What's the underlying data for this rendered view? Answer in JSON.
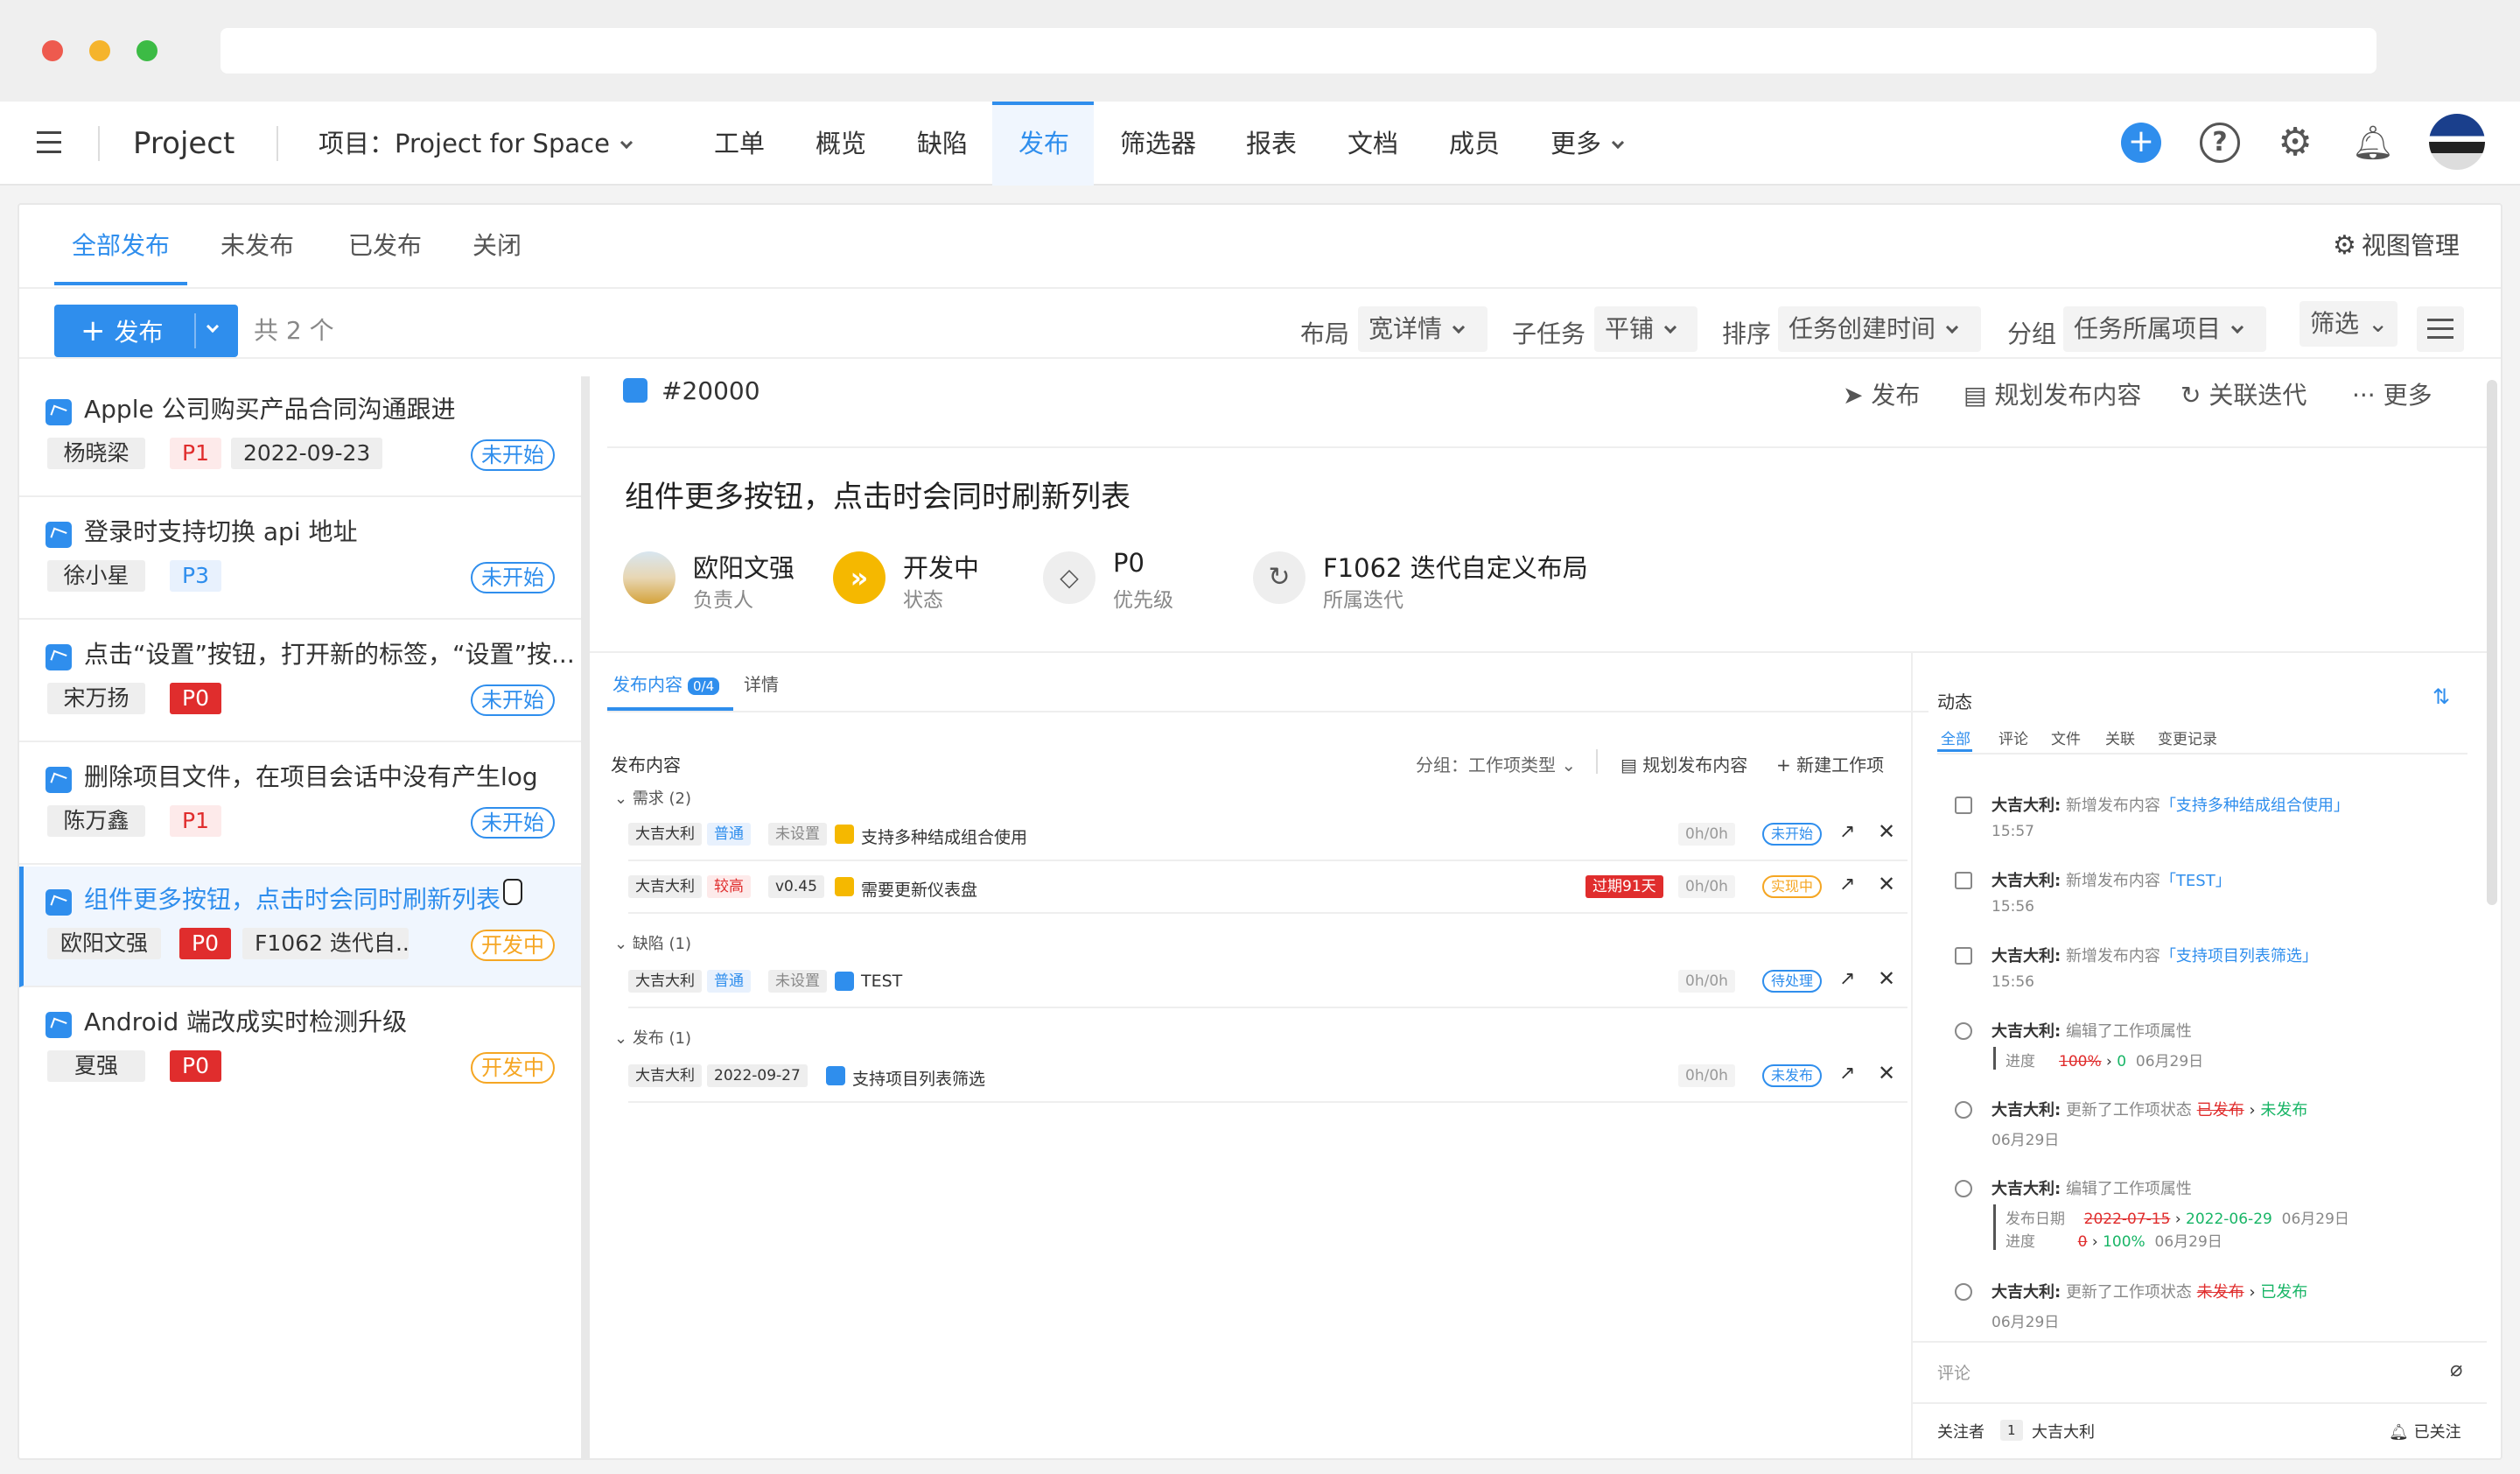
{
  "nav": {
    "project_label": "Project",
    "project_selector": "项目：Project for Space",
    "items": [
      "工单",
      "概览",
      "缺陷",
      "发布",
      "筛选器",
      "报表",
      "文档",
      "成员",
      "更多"
    ]
  },
  "tabs": [
    "全部发布",
    "未发布",
    "已发布",
    "关闭"
  ],
  "view_manage": "视图管理",
  "toolbar": {
    "publish_button": "发布",
    "count_text": "共 2 个",
    "layout_label": "布局",
    "layout_value": "宽详情",
    "subtask_label": "子任务",
    "subtask_value": "平铺",
    "sort_label": "排序",
    "sort_value": "任务创建时间",
    "group_label": "分组",
    "group_value": "任务所属项目",
    "filter_label": "筛选"
  },
  "list": [
    {
      "title": "Apple 公司购买产品合同沟通跟进",
      "tags": [
        "杨晓梁",
        "P1",
        "2022-09-23"
      ],
      "status": "未开始"
    },
    {
      "title": "登录时支持切换 api 地址",
      "tags": [
        "徐小星",
        "P3"
      ],
      "status": "未开始"
    },
    {
      "title": "点击“设置”按钮，打开新的标签，“设置”按...",
      "tags": [
        "宋万扬",
        "P0"
      ],
      "status": "未开始"
    },
    {
      "title": "删除项目文件，在项目会话中没有产生log",
      "tags": [
        "陈万鑫",
        "P1"
      ],
      "status": "未开始"
    },
    {
      "title": "组件更多按钮，点击时会同时刷新列表",
      "tags": [
        "欧阳文强",
        "P0",
        "F1062 迭代自..."
      ],
      "status": "开发中"
    },
    {
      "title": "Android 端改成实时检测升级",
      "tags": [
        "夏强",
        "P0"
      ],
      "status": "开发中"
    }
  ],
  "detail": {
    "id": "#20000",
    "actions": [
      "发布",
      "规划发布内容",
      "关联迭代",
      "更多"
    ],
    "title": "组件更多按钮，点击时会同时刷新列表",
    "fields": [
      {
        "value": "欧阳文强",
        "label": "负责人"
      },
      {
        "value": "开发中",
        "label": "状态"
      },
      {
        "value": "P0",
        "label": "优先级"
      },
      {
        "value": "F1062 迭代自定义布局",
        "label": "所属迭代"
      }
    ],
    "subtabs": {
      "content": "发布内容",
      "badge": "0/4",
      "detail": "详情"
    },
    "content_header": "发布内容",
    "group_by": "分组：工作项类型",
    "plan_button": "规划发布内容",
    "new_item_button": "新建工作项",
    "groups": [
      {
        "name": "需求 (2)",
        "rows": [
          {
            "owner": "大吉大利",
            "prio": "普通",
            "ver": "未设置",
            "title": "支持多种结成组合使用",
            "overdue": "",
            "hours": "0h/0h",
            "status": "未开始"
          },
          {
            "owner": "大吉大利",
            "prio": "较高",
            "ver": "v0.45",
            "title": "需要更新仪表盘",
            "overdue": "过期91天",
            "hours": "0h/0h",
            "status": "实现中"
          }
        ]
      },
      {
        "name": "缺陷 (1)",
        "rows": [
          {
            "owner": "大吉大利",
            "prio": "普通",
            "ver": "未设置",
            "title": "TEST",
            "overdue": "",
            "hours": "0h/0h",
            "status": "待处理"
          }
        ]
      },
      {
        "name": "发布 (1)",
        "rows": [
          {
            "owner": "大吉大利",
            "prio": "2022-09-27",
            "ver": "",
            "title": "支持项目列表筛选",
            "overdue": "",
            "hours": "0h/0h",
            "status": "未发布"
          }
        ]
      }
    ]
  },
  "activity": {
    "title": "动态",
    "tabs": [
      "全部",
      "评论",
      "文件",
      "关联",
      "变更记录"
    ],
    "items": [
      {
        "user": "大吉大利:",
        "text": "新增发布内容",
        "link": "「支持多种结成组合使用」",
        "time": "15:57"
      },
      {
        "user": "大吉大利:",
        "text": "新增发布内容",
        "link": "「TEST」",
        "time": "15:56"
      },
      {
        "user": "大吉大利:",
        "text": "新增发布内容",
        "link": "「支持项目列表筛选」",
        "time": "15:56"
      },
      {
        "user": "大吉大利:",
        "text": "编辑了工作项属性",
        "sub_label": "进度",
        "old": "100%",
        "new": "0",
        "time": "06月29日"
      },
      {
        "user": "大吉大利:",
        "text": "更新了工作项状态",
        "old": "已发布",
        "new": "未发布",
        "time": "06月29日"
      },
      {
        "user": "大吉大利:",
        "text": "编辑了工作项属性",
        "sub_label": "发布日期",
        "old": "2022-07-15",
        "new": "2022-06-29",
        "time": "06月29日",
        "sub_label2": "进度",
        "old2": "0",
        "new2": "100%",
        "time2": "06月29日"
      },
      {
        "user": "大吉大利:",
        "text": "更新了工作项状态",
        "old": "未发布",
        "new": "已发布",
        "time": "06月29日"
      }
    ],
    "comment_placeholder": "评论",
    "followers_label": "关注者",
    "followers_count": "1",
    "follower_name": "大吉大利",
    "follow_status": "已关注"
  }
}
